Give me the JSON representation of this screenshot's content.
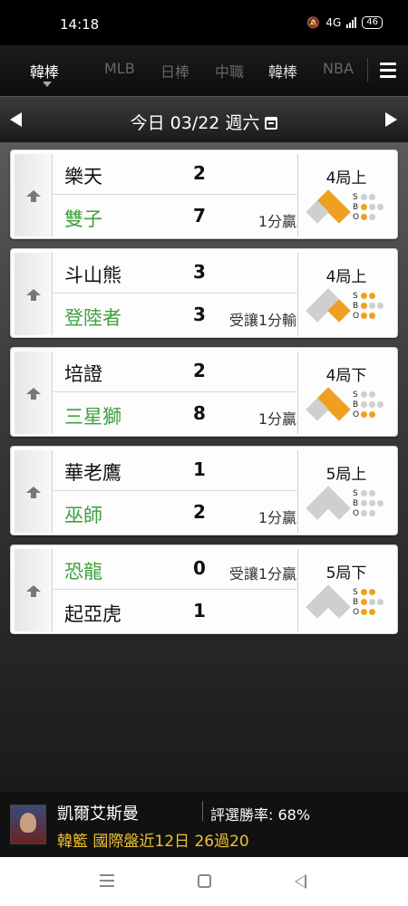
{
  "status_bar": {
    "time": "14:18",
    "network": "4G",
    "battery": "46"
  },
  "tabs": [
    {
      "label": "韓棒",
      "state": "active"
    },
    {
      "label": "MLB",
      "state": "dim"
    },
    {
      "label": "日棒",
      "state": "dim"
    },
    {
      "label": "中職",
      "state": "dim"
    },
    {
      "label": "韓棒",
      "state": "highlight"
    },
    {
      "label": "NBA",
      "state": "dim"
    }
  ],
  "date_bar": {
    "label": "今日 03/22 週六"
  },
  "games": [
    {
      "home": {
        "name": "樂天",
        "score": "2",
        "color": "dark",
        "note": ""
      },
      "away": {
        "name": "雙子",
        "score": "7",
        "color": "green",
        "note": "1分贏"
      },
      "inning": "4局上",
      "bases": {
        "first": true,
        "second": true,
        "third": false
      },
      "count": {
        "s": 0,
        "b": 1,
        "o": 1
      }
    },
    {
      "home": {
        "name": "斗山熊",
        "score": "3",
        "color": "dark",
        "note": ""
      },
      "away": {
        "name": "登陸者",
        "score": "3",
        "color": "green",
        "note": "受讓1分輸"
      },
      "inning": "4局上",
      "bases": {
        "first": true,
        "second": false,
        "third": false
      },
      "count": {
        "s": 2,
        "b": 1,
        "o": 2
      }
    },
    {
      "home": {
        "name": "培證",
        "score": "2",
        "color": "dark",
        "note": ""
      },
      "away": {
        "name": "三星獅",
        "score": "8",
        "color": "green",
        "note": "1分贏"
      },
      "inning": "4局下",
      "bases": {
        "first": true,
        "second": true,
        "third": false
      },
      "count": {
        "s": 0,
        "b": 0,
        "o": 2
      }
    },
    {
      "home": {
        "name": "華老鷹",
        "score": "1",
        "color": "dark",
        "note": ""
      },
      "away": {
        "name": "巫師",
        "score": "2",
        "color": "green",
        "note": "1分贏"
      },
      "inning": "5局上",
      "bases": {
        "first": false,
        "second": false,
        "third": false
      },
      "count": {
        "s": 0,
        "b": 0,
        "o": 0
      }
    },
    {
      "home": {
        "name": "恐龍",
        "score": "0",
        "color": "green",
        "note": "受讓1分贏"
      },
      "away": {
        "name": "起亞虎",
        "score": "1",
        "color": "dark",
        "note": ""
      },
      "inning": "5局下",
      "bases": {
        "first": false,
        "second": false,
        "third": false
      },
      "count": {
        "s": 2,
        "b": 1,
        "o": 2
      }
    }
  ],
  "banner": {
    "analyst": "凱爾艾斯曼",
    "win_rate": "評選勝率: 68%",
    "record": "韓籃 國際盤近12日 26過20"
  },
  "colors": {
    "accent_green": "#3fa03f",
    "runner_orange": "#f0a020",
    "record_yellow": "#f0c030"
  }
}
